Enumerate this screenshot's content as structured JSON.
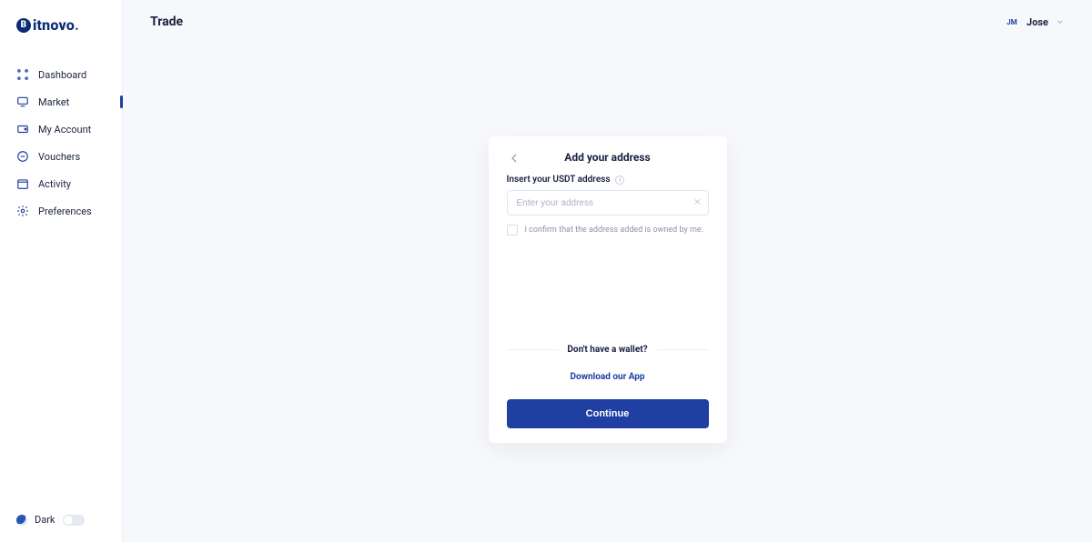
{
  "brand": {
    "name": "itnovo",
    "mark": "B"
  },
  "header": {
    "title": "Trade"
  },
  "user": {
    "initials": "JM",
    "name": "Jose"
  },
  "sidebar": {
    "items": [
      {
        "label": "Dashboard"
      },
      {
        "label": "Market"
      },
      {
        "label": "My Account"
      },
      {
        "label": "Vouchers"
      },
      {
        "label": "Activity"
      },
      {
        "label": "Preferences"
      }
    ],
    "dark_label": "Dark"
  },
  "card": {
    "title": "Add your address",
    "label": "Insert your USDT address",
    "placeholder": "Enter your address",
    "confirm_text": "I confirm that the address added is owned by me.",
    "no_wallet": "Don't have a wallet?",
    "download": "Download our App",
    "continue": "Continue"
  }
}
